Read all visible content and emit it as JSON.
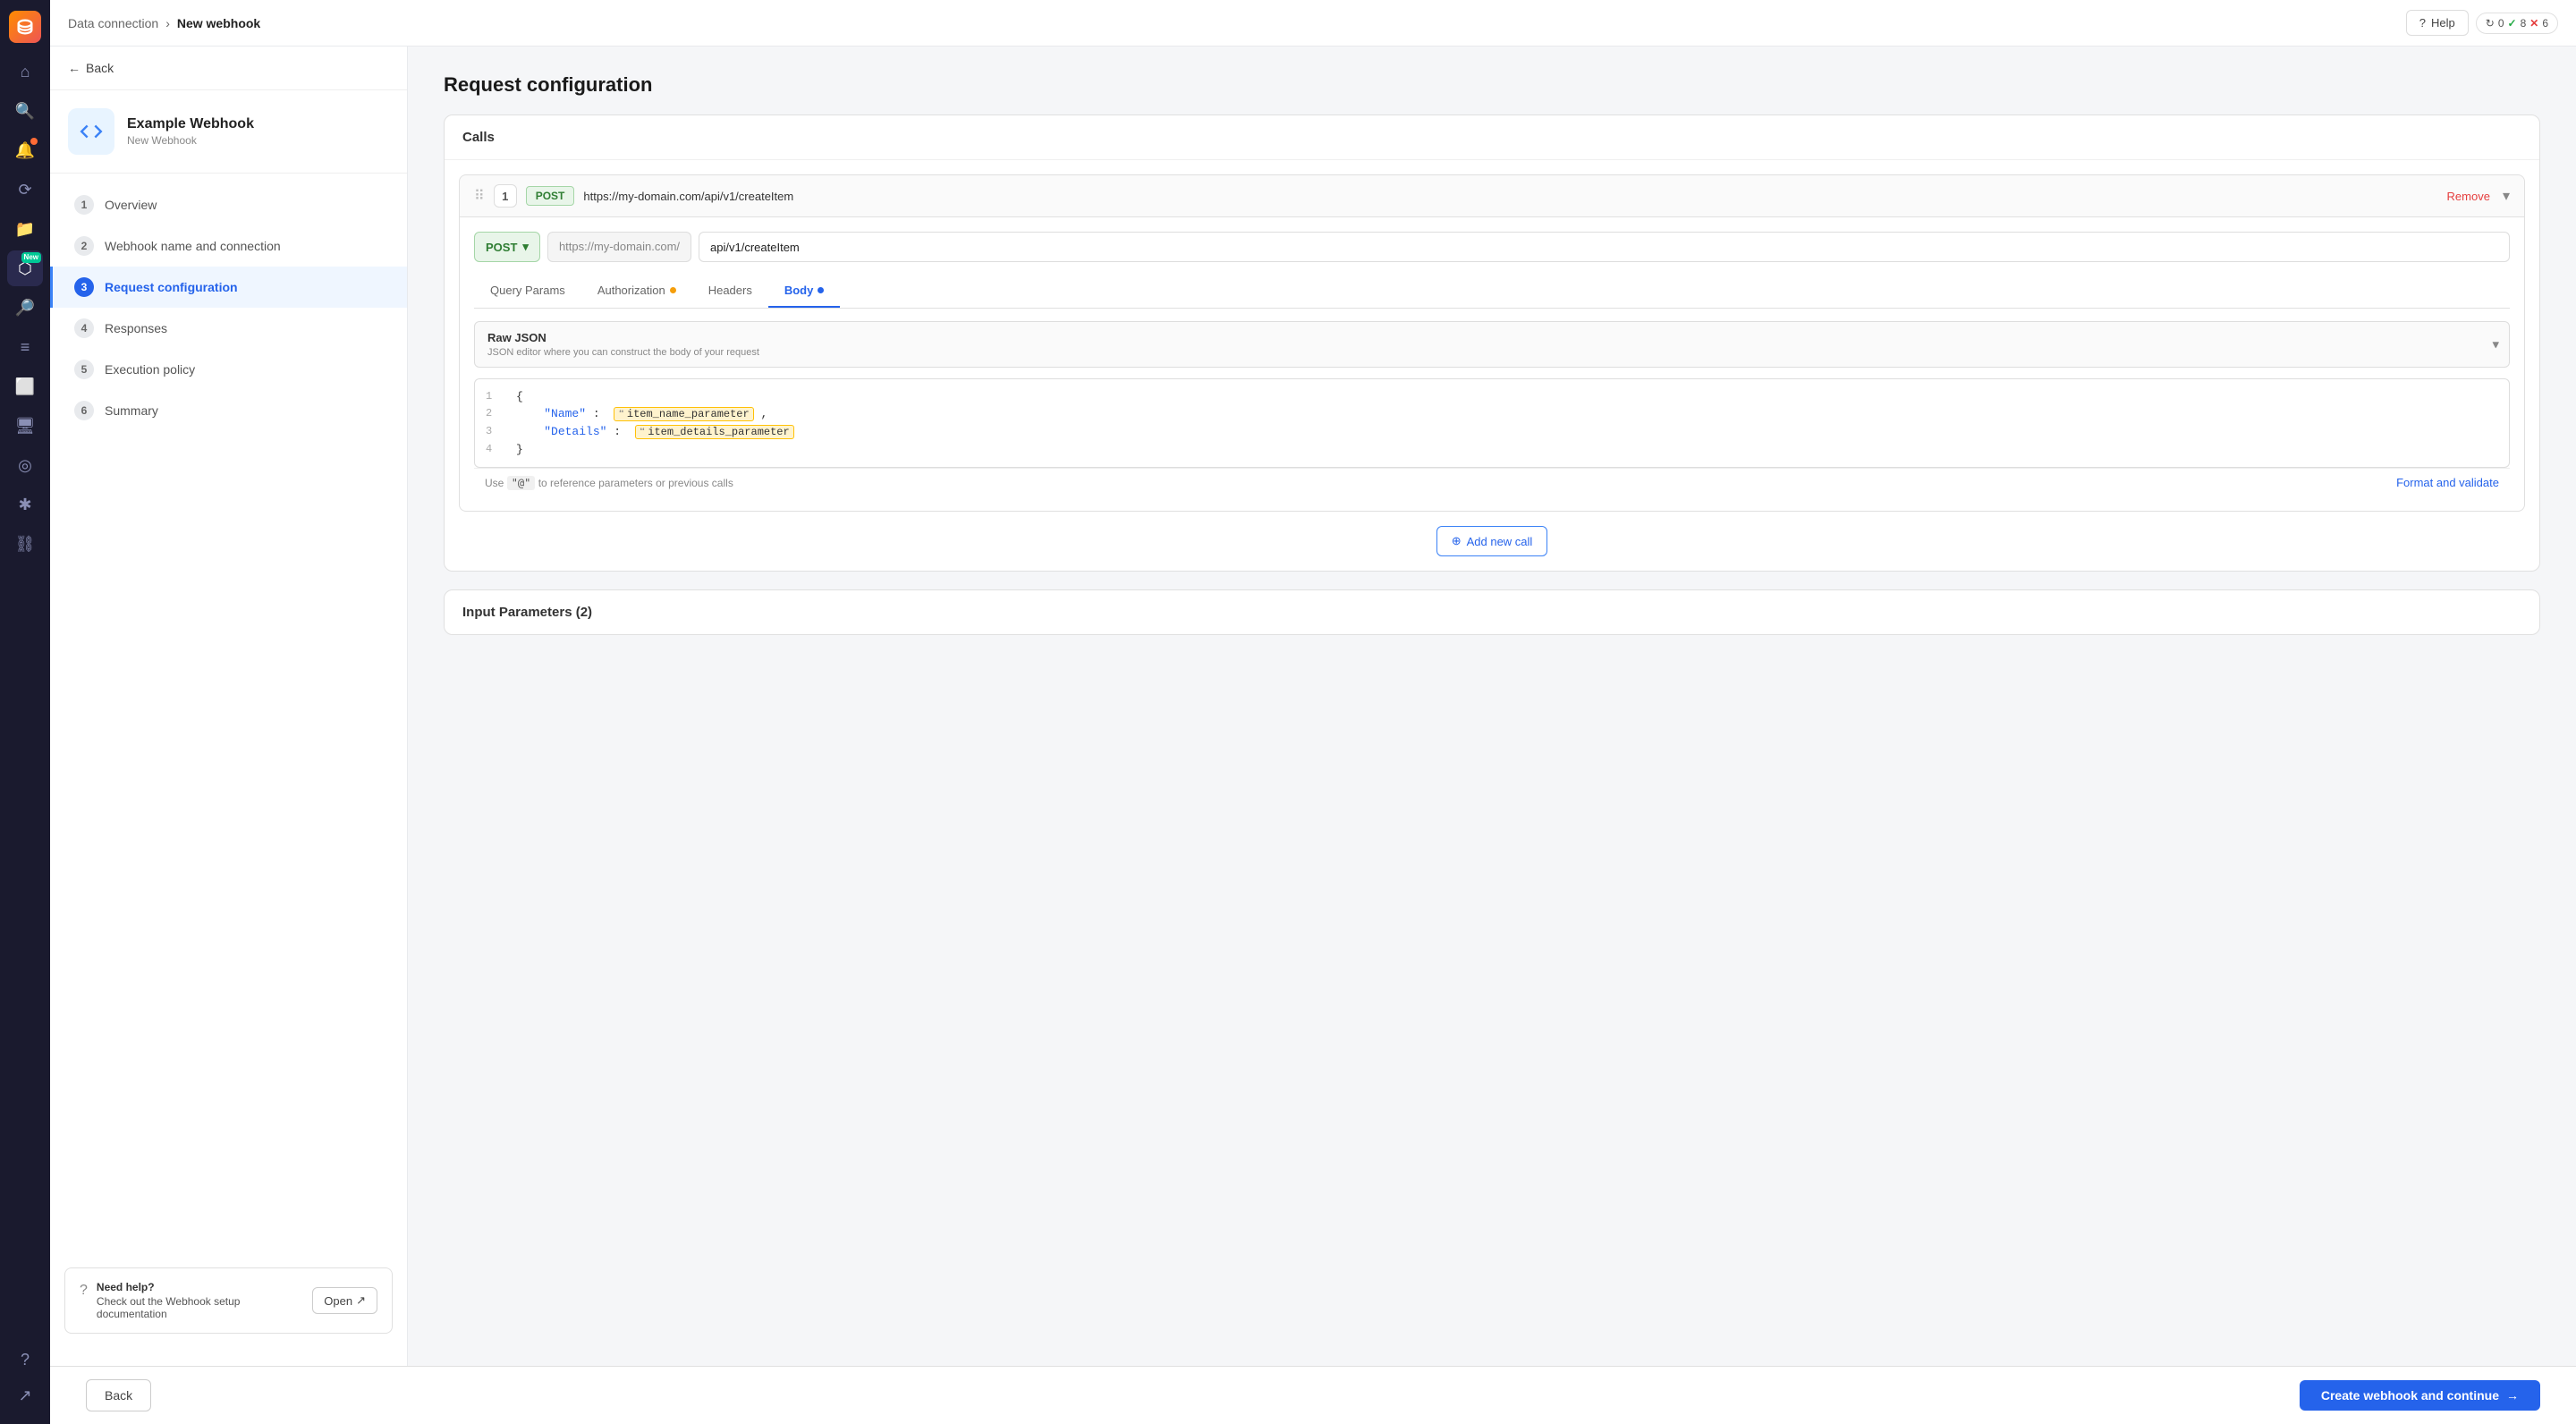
{
  "topbar": {
    "breadcrumb_parent": "Data connection",
    "breadcrumb_sep": "›",
    "breadcrumb_current": "New webhook",
    "help_label": "Help",
    "status_0": "0",
    "status_checks": "8",
    "status_errors": "6"
  },
  "sidebar": {
    "back_label": "Back",
    "webhook_name": "Example Webhook",
    "webhook_sub": "New Webhook",
    "steps": [
      {
        "num": "1",
        "label": "Overview"
      },
      {
        "num": "2",
        "label": "Webhook name and connection"
      },
      {
        "num": "3",
        "label": "Request configuration"
      },
      {
        "num": "4",
        "label": "Responses"
      },
      {
        "num": "5",
        "label": "Execution policy"
      },
      {
        "num": "6",
        "label": "Summary"
      }
    ],
    "help_title": "Need help?",
    "help_desc": "Check out the Webhook setup documentation",
    "help_btn": "Open"
  },
  "main": {
    "page_title": "Request configuration",
    "calls_card_title": "Calls",
    "call": {
      "num": "1",
      "method": "POST",
      "url_display": "https://my-domain.com/api/v1/createItem",
      "remove_label": "Remove",
      "url_base": "https://my-domain.com/",
      "url_path": "api/v1/createItem",
      "tabs": [
        {
          "id": "query",
          "label": "Query Params"
        },
        {
          "id": "auth",
          "label": "Authorization",
          "dot": "orange"
        },
        {
          "id": "headers",
          "label": "Headers"
        },
        {
          "id": "body",
          "label": "Body",
          "dot": "blue"
        }
      ],
      "body_type": "Raw JSON",
      "body_type_sub": "JSON editor where you can construct the body of your request",
      "code_lines": [
        {
          "num": "1",
          "content": "{"
        },
        {
          "num": "2",
          "content": "    \"Name\" :  {{item_name_parameter}},"
        },
        {
          "num": "3",
          "content": "    \"Details\" :  {{item_details_parameter}}"
        },
        {
          "num": "4",
          "content": "}"
        }
      ],
      "editor_hint": "Use",
      "editor_hint_code": "\"@\"",
      "editor_hint_rest": "to reference parameters or previous calls",
      "format_validate": "Format and validate"
    },
    "add_call_label": "Add new call",
    "input_params_title": "Input Parameters (2)",
    "back_btn": "Back",
    "create_btn": "Create webhook and continue",
    "new_badge": "New"
  }
}
